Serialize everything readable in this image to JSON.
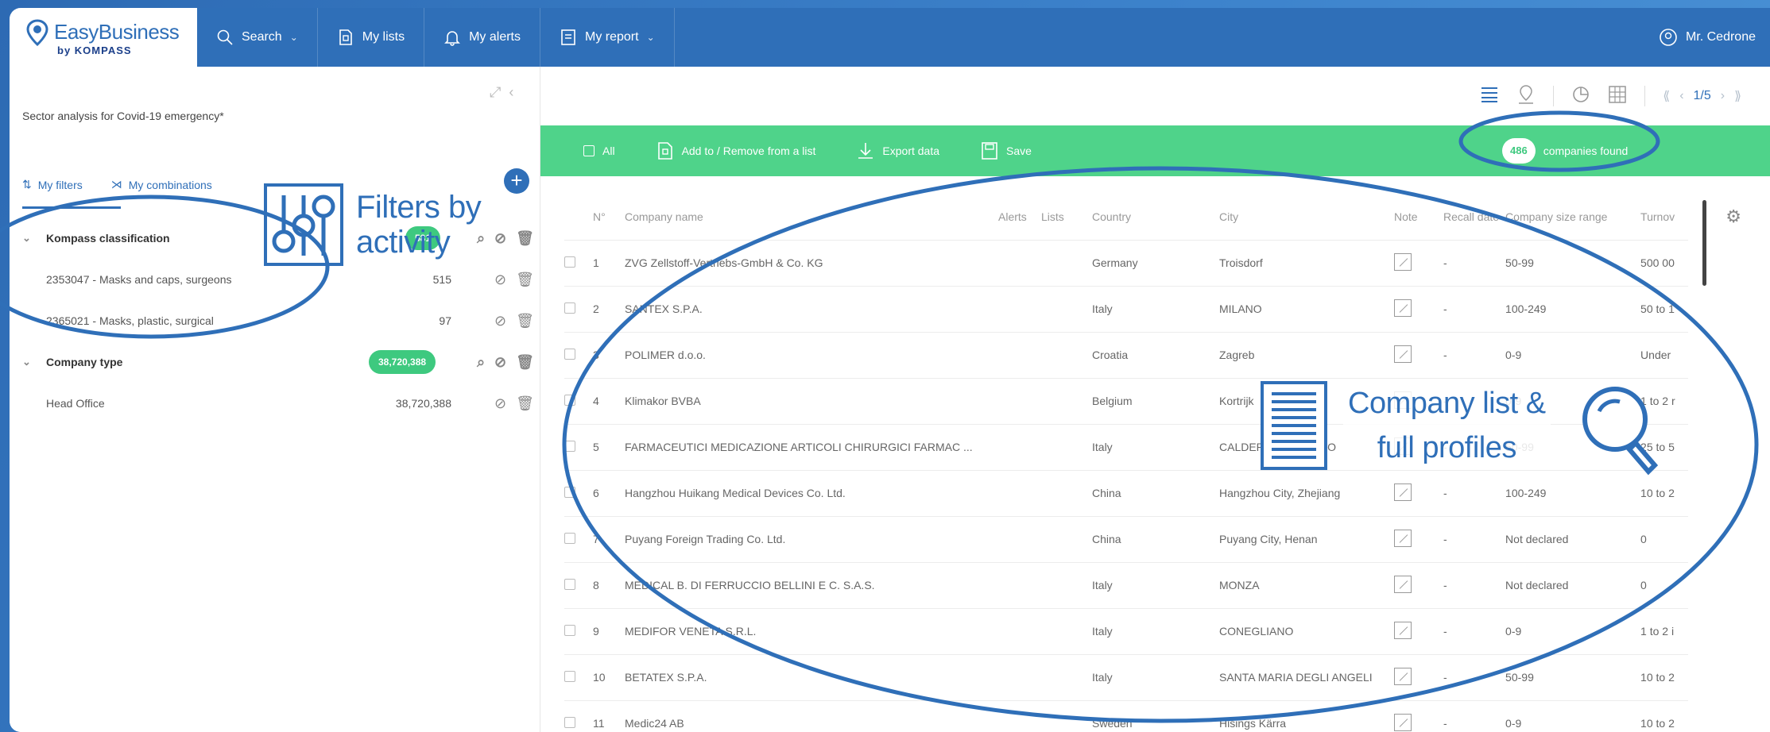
{
  "brand": {
    "name": "EasyBusiness",
    "sub": "by KOMPASS"
  },
  "nav": {
    "search": "Search",
    "my_lists": "My lists",
    "my_alerts": "My alerts",
    "my_report": "My report",
    "user": "Mr. Cedrone"
  },
  "left": {
    "sector_title": "Sector analysis for Covid-19 emergency*",
    "tab_filters": "My filters",
    "tab_combinations": "My combinations",
    "tree": [
      {
        "type": "group",
        "label": "Kompass classification",
        "badge": "581"
      },
      {
        "type": "item",
        "label": "2353047 - Masks and caps, surgeons",
        "count": "515"
      },
      {
        "type": "item",
        "label": "2365021 - Masks, plastic, surgical",
        "count": "97"
      },
      {
        "type": "group",
        "label": "Company type",
        "badge": "38,720,388"
      },
      {
        "type": "item",
        "label": "Head Office",
        "count": "38,720,388"
      }
    ]
  },
  "annotations": {
    "filters_line1": "Filters by",
    "filters_line2": "activity",
    "list_line1": "Company list &",
    "list_line2": "full profiles"
  },
  "toolbar": {
    "pager": "1/5",
    "all": "All",
    "add_remove": "Add to / Remove from a list",
    "export": "Export data",
    "save": "Save",
    "found_count": "486",
    "found_label": "companies found"
  },
  "table": {
    "headers": {
      "num": "N°",
      "name": "Company name",
      "alerts": "Alerts",
      "lists": "Lists",
      "country": "Country",
      "city": "City",
      "note": "Note",
      "recall": "Recall date",
      "size": "Company size range",
      "turnover": "Turnov"
    },
    "rows": [
      {
        "num": "1",
        "name": "ZVG Zellstoff-Vertriebs-GmbH & Co. KG",
        "country": "Germany",
        "city": "Troisdorf",
        "recall": "-",
        "size": "50-99",
        "turnover": "500 00"
      },
      {
        "num": "2",
        "name": "SANTEX S.P.A.",
        "country": "Italy",
        "city": "MILANO",
        "recall": "-",
        "size": "100-249",
        "turnover": "50 to 1"
      },
      {
        "num": "3",
        "name": "POLIMER d.o.o.",
        "country": "Croatia",
        "city": "Zagreb",
        "recall": "-",
        "size": "0-9",
        "turnover": "Under"
      },
      {
        "num": "4",
        "name": "Klimakor BVBA",
        "country": "Belgium",
        "city": "Kortrijk",
        "recall": "-",
        "size": "0-9",
        "turnover": "1 to 2 r"
      },
      {
        "num": "5",
        "name": "FARMACEUTICI MEDICAZIONE ARTICOLI CHIRURGICI FARMAC ...",
        "country": "Italy",
        "city": "CALDERARA DI RENO",
        "recall": "-",
        "size": "50-99",
        "turnover": "25 to 5"
      },
      {
        "num": "6",
        "name": "Hangzhou Huikang Medical Devices Co. Ltd.",
        "country": "China",
        "city": "Hangzhou City, Zhejiang",
        "recall": "-",
        "size": "100-249",
        "turnover": "10 to 2"
      },
      {
        "num": "7",
        "name": "Puyang Foreign Trading Co. Ltd.",
        "country": "China",
        "city": "Puyang City, Henan",
        "recall": "-",
        "size": "Not declared",
        "turnover": "0"
      },
      {
        "num": "8",
        "name": "MEDICAL B. DI FERRUCCIO BELLINI E C. S.A.S.",
        "country": "Italy",
        "city": "MONZA",
        "recall": "-",
        "size": "Not declared",
        "turnover": "0"
      },
      {
        "num": "9",
        "name": "MEDIFOR VENETA S.R.L.",
        "country": "Italy",
        "city": "CONEGLIANO",
        "recall": "-",
        "size": "0-9",
        "turnover": "1 to 2 i"
      },
      {
        "num": "10",
        "name": "BETATEX S.P.A.",
        "country": "Italy",
        "city": "SANTA MARIA DEGLI ANGELI",
        "recall": "-",
        "size": "50-99",
        "turnover": "10 to 2"
      },
      {
        "num": "11",
        "name": "Medic24 AB",
        "country": "Sweden",
        "city": "Hisings Kärra",
        "recall": "-",
        "size": "0-9",
        "turnover": "10 to 2"
      }
    ]
  },
  "colors": {
    "brand_blue": "#2f6fb8",
    "green": "#4fd38a",
    "badge_green": "#3ec97f"
  }
}
